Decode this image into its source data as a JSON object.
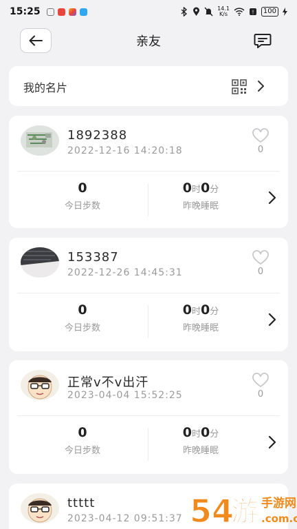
{
  "status_bar": {
    "time": "15:25",
    "net_speed_top": "14.1",
    "net_speed_bottom": "K/s",
    "battery": "100"
  },
  "header": {
    "title": "亲友"
  },
  "my_card": {
    "label": "我的名片"
  },
  "friends": [
    {
      "name": "1892388",
      "time": "2022-12-16  14:20:18",
      "likes": "0",
      "steps": "0",
      "steps_label": "今日步数",
      "sleep_hours": "0",
      "sleep_hours_unit": "时",
      "sleep_minutes": "0",
      "sleep_minutes_unit": "分",
      "sleep_label": "昨晚睡眠"
    },
    {
      "name": "153387",
      "time": "2022-12-26  14:45:31",
      "likes": "0",
      "steps": "0",
      "steps_label": "今日步数",
      "sleep_hours": "0",
      "sleep_hours_unit": "时",
      "sleep_minutes": "0",
      "sleep_minutes_unit": "分",
      "sleep_label": "昨晚睡眠"
    },
    {
      "name": "正常v不v出汗",
      "time": "2023-04-04  15:52:25",
      "likes": "0",
      "steps": "0",
      "steps_label": "今日步数",
      "sleep_hours": "0",
      "sleep_hours_unit": "时",
      "sleep_minutes": "0",
      "sleep_minutes_unit": "分",
      "sleep_label": "昨晚睡眠"
    },
    {
      "name": "ttttt",
      "time": "2023-04-12  09:51:37"
    }
  ],
  "watermark": {
    "text": "54游 手游网 .com.cn"
  },
  "colors": {
    "background": "#f2f2f4",
    "card": "#ffffff",
    "watermark_orange": "#f08a1c"
  }
}
